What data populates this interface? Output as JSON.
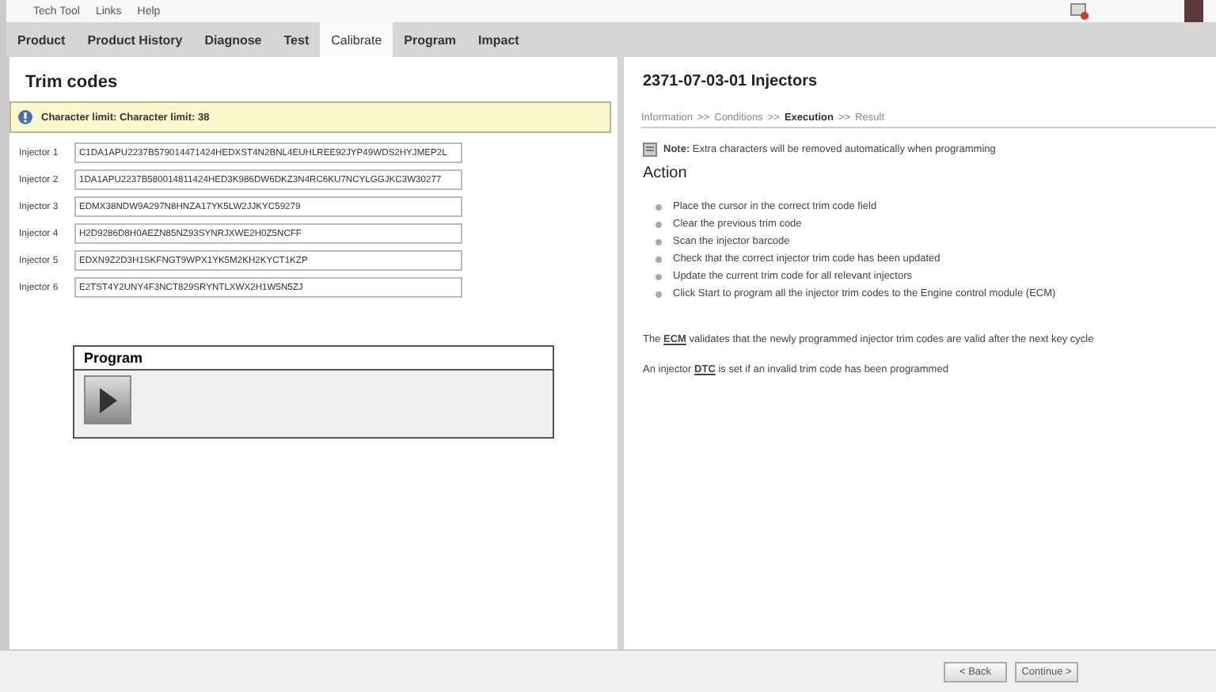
{
  "menu": [
    "Tech Tool",
    "Links",
    "Help"
  ],
  "tabs": [
    {
      "label": "Product",
      "selected": false
    },
    {
      "label": "Product History",
      "selected": false
    },
    {
      "label": "Diagnose",
      "selected": false
    },
    {
      "label": "Test",
      "selected": false
    },
    {
      "label": "Calibrate",
      "selected": true
    },
    {
      "label": "Program",
      "selected": false
    },
    {
      "label": "Impact",
      "selected": false
    }
  ],
  "left": {
    "title": "Trim codes",
    "info": "Character limit: Character limit: 38",
    "injectors": [
      {
        "label": "Injector 1",
        "value": "C1DA1APU2237B579014471424HEDXST4N2BNL4EUHLREE92JYP49WDS2HYJMEP2L"
      },
      {
        "label": "Injector 2",
        "value": "1DA1APU2237B580014811424HED3K986DW6DKZ3N4RC6KU7NCYLGGJKC3W30277"
      },
      {
        "label": "Injector 3",
        "value": "EDMX38NDW9A297N8HNZA17YK5LW2JJKYC59279"
      },
      {
        "label": "Injector 4",
        "value": "H2D9286D8H0AEZN85NZ93SYNRJXWE2H0Z5NCFF"
      },
      {
        "label": "Injector 5",
        "value": "EDXN9Z2D3H1SKFNGT9WPX1YK5M2KH2KYCT1KZP"
      },
      {
        "label": "Injector 6",
        "value": "E2TST4Y2UNY4F3NCT829SRYNTLXWX2H1W5N5ZJ"
      }
    ],
    "program_title": "Program"
  },
  "right": {
    "title": "2371-07-03-01 Injectors",
    "steps": [
      {
        "label": "Information",
        "selected": false
      },
      {
        "label": "Conditions",
        "selected": false
      },
      {
        "label": "Execution",
        "selected": true
      },
      {
        "label": "Result",
        "selected": false
      }
    ],
    "step_separator": ">>",
    "note": "**Note:** Extra characters will be removed automatically when programming",
    "action_title": "Action",
    "actions": [
      "Place the cursor in the correct trim code field",
      "Clear the previous trim code",
      "Scan the injector barcode",
      "Check that the correct injector trim code has been updated",
      "Update the current trim code for all relevant injectors",
      "Click Start to program all the injector trim codes to the Engine control module (ECM)"
    ],
    "paragraphs": [
      {
        "before": "The",
        "link": "ECM",
        "after": "validates that the newly programmed injector trim codes are valid after the next key cycle"
      },
      {
        "before": "An injector",
        "link": "DTC",
        "after": "is set if an invalid trim code has been programmed"
      }
    ]
  },
  "footer": {
    "back": "< Back",
    "continue": "Continue >"
  }
}
